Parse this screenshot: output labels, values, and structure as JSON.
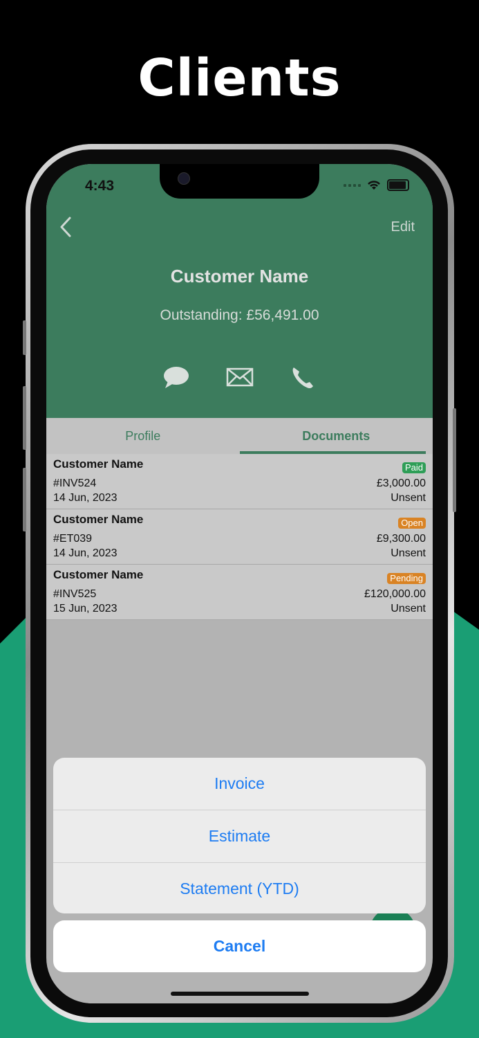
{
  "headline": "Clients",
  "status_bar": {
    "time": "4:43"
  },
  "nav": {
    "edit_label": "Edit"
  },
  "customer": {
    "name": "Customer Name",
    "outstanding": "Outstanding: £56,491.00"
  },
  "actions": {
    "icons": [
      "message-icon",
      "mail-icon",
      "phone-icon"
    ]
  },
  "tabs": [
    {
      "label": "Profile",
      "active": false
    },
    {
      "label": "Documents",
      "active": true
    }
  ],
  "documents": [
    {
      "name": "Customer Name",
      "number": "#INV524",
      "date": "14 Jun, 2023",
      "status": "Paid",
      "status_color": "#2e9e57",
      "amount": "£3,000.00",
      "sent_state": "Unsent"
    },
    {
      "name": "Customer Name",
      "number": "#ET039",
      "date": "14 Jun, 2023",
      "status": "Open",
      "status_color": "#d98324",
      "amount": "£9,300.00",
      "sent_state": "Unsent"
    },
    {
      "name": "Customer Name",
      "number": "#INV525",
      "date": "15 Jun, 2023",
      "status": "Pending",
      "status_color": "#d98324",
      "amount": "£120,000.00",
      "sent_state": "Unsent"
    }
  ],
  "action_sheet": {
    "options": [
      "Invoice",
      "Estimate",
      "Statement (YTD)"
    ],
    "cancel_label": "Cancel"
  },
  "colors": {
    "brand": "#3c7c5d",
    "background_accent": "#1a9e74",
    "link": "#1d7cf2"
  }
}
